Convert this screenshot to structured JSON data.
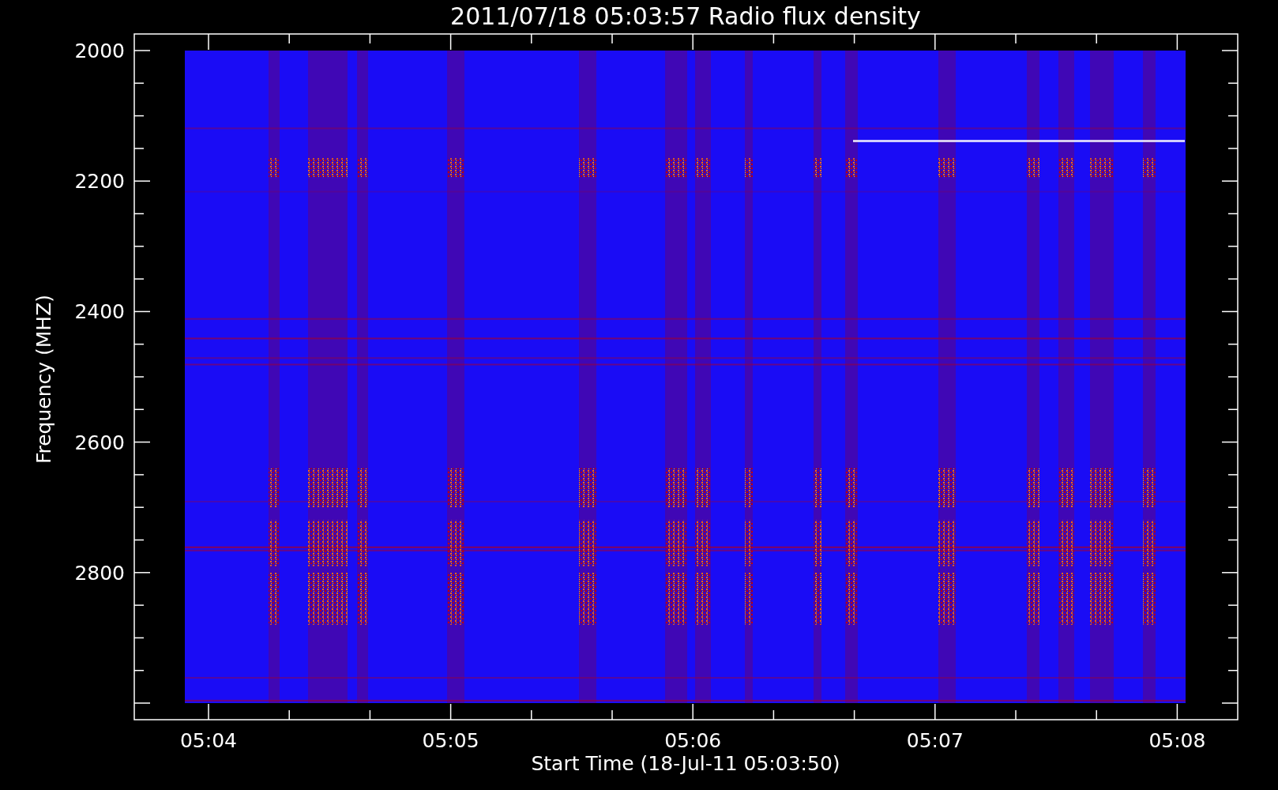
{
  "title": "2011/07/18 05:03:57 Radio flux density",
  "y_axis": {
    "label": "Frequency (MHZ)",
    "ticks": [
      "2000",
      "2200",
      "2400",
      "2600",
      "2800"
    ]
  },
  "x_axis": {
    "label": "Start Time (18-Jul-11 05:03:50)",
    "ticks": [
      "05:04",
      "05:05",
      "05:06",
      "05:07",
      "05:08"
    ]
  }
}
